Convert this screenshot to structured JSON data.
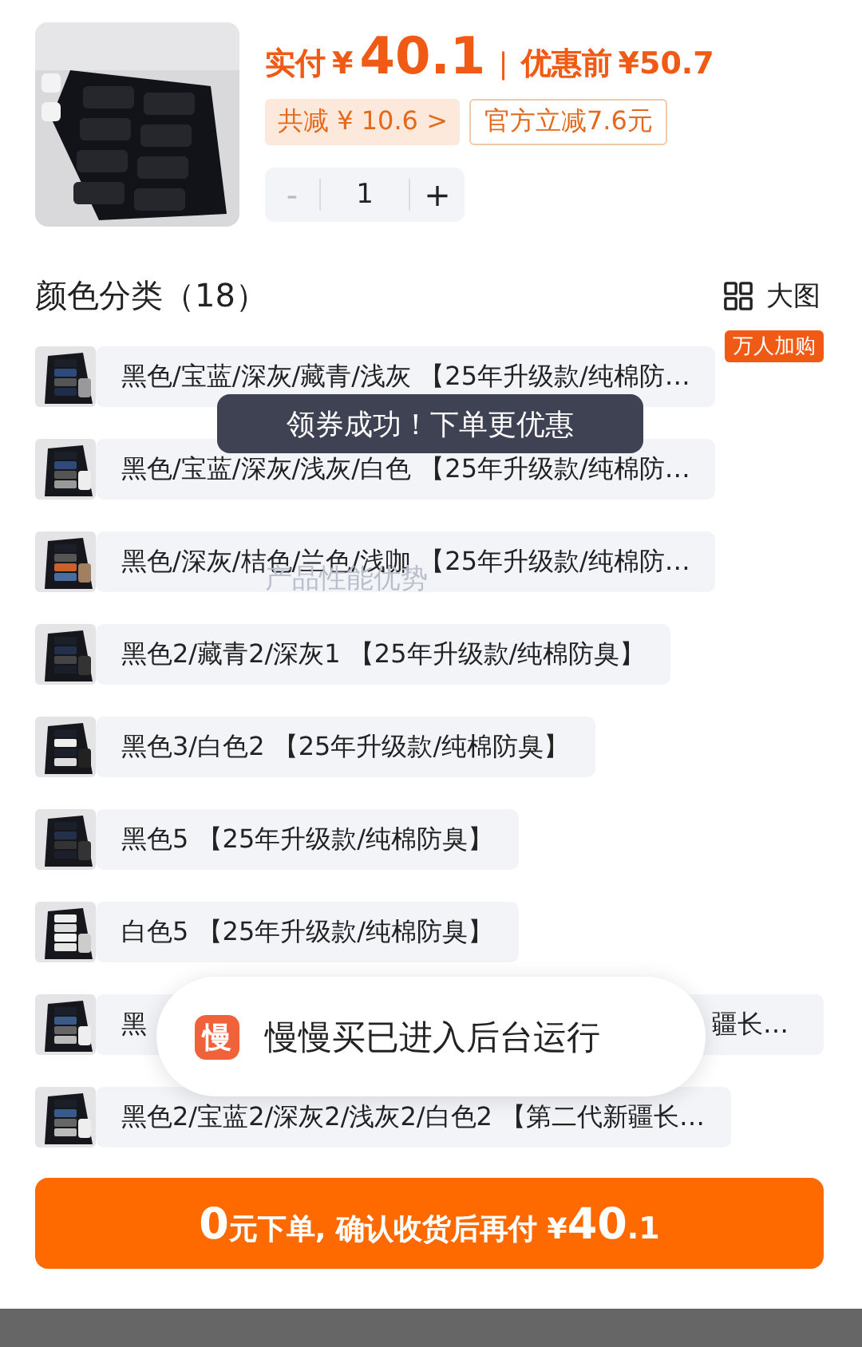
{
  "product": {
    "price": {
      "label": "实付",
      "currency": "¥",
      "amount": "40.1",
      "divider": "|",
      "original_label": "优惠前",
      "original_price": "¥50.7"
    },
    "tags": [
      {
        "kind": "total",
        "text": "共减 ¥ 10.6",
        "arrow": ">"
      },
      {
        "kind": "official",
        "text": "官方立减7.6元"
      }
    ],
    "stepper": {
      "minus": "-",
      "value": "1",
      "plus": "+",
      "minus_disabled": true
    }
  },
  "section": {
    "title": "颜色分类（18）",
    "view_toggle": "大图"
  },
  "variants": [
    {
      "text": "黑色/宝蓝/深灰/藏青/浅灰 【25年升级款/纯棉防…",
      "badge": "万人加购"
    },
    {
      "text": "黑色/宝蓝/深灰/浅灰/白色 【25年升级款/纯棉防…"
    },
    {
      "text": "黑色/深灰/桔色/兰色/浅咖 【25年升级款/纯棉防…"
    },
    {
      "text": "黑色2/藏青2/深灰1 【25年升级款/纯棉防臭】"
    },
    {
      "text": "黑色3/白色2 【25年升级款/纯棉防臭】"
    },
    {
      "text": "黑色5 【25年升级款/纯棉防臭】"
    },
    {
      "text": "白色5 【25年升级款/纯棉防臭】"
    },
    {
      "text_left": "黑",
      "text_right": "疆长…"
    },
    {
      "text": "黑色2/宝蓝2/深灰2/浅灰2/白色2 【第二代新疆长…"
    }
  ],
  "ghost_heading": "产品性能优势",
  "toast": "领券成功！下单更优惠",
  "notification": {
    "icon_glyph": "慢",
    "text": "慢慢买已进入后台运行"
  },
  "order_button": {
    "parts": [
      {
        "kind": "big",
        "text": "0"
      },
      {
        "kind": "small",
        "text": "元下单, 确认收货后再付 ¥"
      },
      {
        "kind": "big",
        "text": "40"
      },
      {
        "kind": "tiny",
        "text": ".1"
      }
    ]
  },
  "system_bar": {
    "kind": "bar"
  }
}
